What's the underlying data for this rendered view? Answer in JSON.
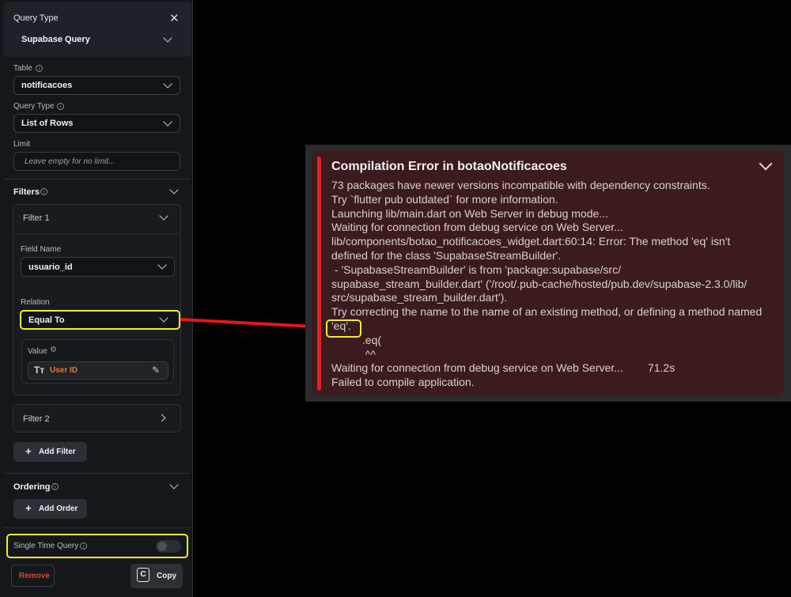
{
  "panel": {
    "query_type_label": "Query Type",
    "query_type_value": "Supabase Query",
    "table_label": "Table",
    "table_value": "notificacoes",
    "query_type2_label": "Query Type",
    "query_type2_value": "List of Rows",
    "limit_label": "Limit",
    "limit_placeholder": "Leave empty for no limit...",
    "filters_label": "Filters",
    "filter1_label": "Filter 1",
    "field_name_label": "Field Name",
    "field_name_value": "usuario_id",
    "relation_label": "Relation",
    "relation_value": "Equal To",
    "value_label": "Value",
    "value_text": "User ID",
    "value_type_glyph": "Tт",
    "filter2_label": "Filter 2",
    "add_filter": "Add Filter",
    "ordering_label": "Ordering",
    "add_order": "Add Order",
    "single_time_label": "Single Time Query",
    "single_time_enabled": false,
    "remove": "Remove",
    "copy": "Copy"
  },
  "error": {
    "title": "Compilation Error in botaoNotificacoes",
    "lines": [
      "73 packages have newer versions incompatible with dependency constraints.",
      "Try `flutter pub outdated` for more information.",
      "Launching lib/main.dart on Web Server in debug mode...",
      "Waiting for connection from debug service on Web Server...",
      "lib/components/botao_notificacoes_widget.dart:60:14: Error: The method 'eq' isn't",
      "defined for the class 'SupabaseStreamBuilder'.",
      " - 'SupabaseStreamBuilder' is from 'package:supabase/src/",
      "supabase_stream_builder.dart' ('/root/.pub-cache/hosted/pub.dev/supabase-2.3.0/lib/",
      "src/supabase_stream_builder.dart').",
      "Try correcting the name to the name of an existing method, or defining a method named",
      "'eq'.",
      "          .eq(",
      "           ^^",
      "Waiting for connection from debug service on Web Server...        71.2s",
      "Failed to compile application."
    ]
  },
  "colors": {
    "highlight": "#f3ee2a",
    "arrow": "#e8141a",
    "error_bar": "#e0202a",
    "remove": "#e2452e",
    "value_text": "#e8773a"
  }
}
